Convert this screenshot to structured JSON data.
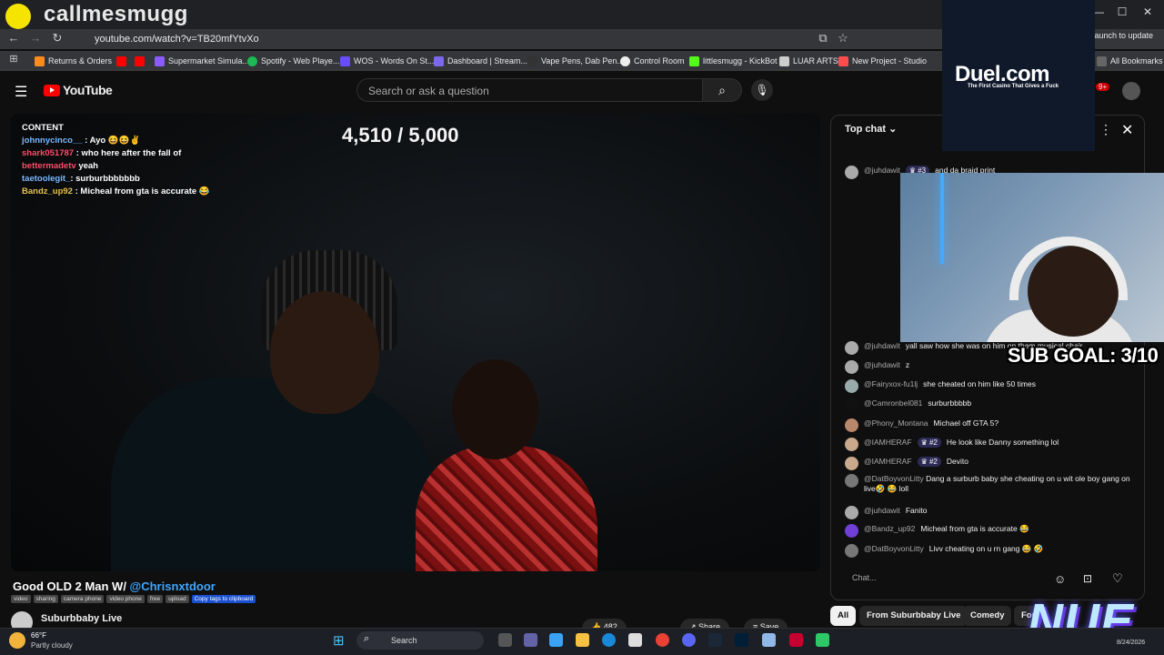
{
  "overlay": {
    "streamer_name": "callmesmugg",
    "counter": "4,510 / 5,000",
    "sub_goal": "SUB GOAL: 3/10",
    "sponsor_title": "Duel.com",
    "sponsor_sub": "The First Casino That Gives a Fuck",
    "brand": "NUE"
  },
  "browser": {
    "url": "youtube.com/watch?v=TB20mfYtvXo",
    "relaunch": "Relaunch to update",
    "bookmarks": [
      "Returns & Orders",
      "Supermarket Simula...",
      "Spotify - Web Playe...",
      "WOS - Words On St...",
      "Dashboard | Stream...",
      "Vape Pens, Dab Pen...",
      "Control Room",
      "littlesmugg - KickBot",
      "LUAR ARTS",
      "New Project - Studio",
      "All Bookmarks"
    ],
    "colors": {
      "frame": "#202124",
      "toolbar": "#35363a"
    }
  },
  "youtube": {
    "logo": "YouTube",
    "search_placeholder": "Search or ask a question",
    "notif_count": "9+"
  },
  "stream_chat": [
    {
      "user": "CONTENT",
      "text": ""
    },
    {
      "user": "johnnycinco__",
      "text": ": Ayo 😆😆✌"
    },
    {
      "user": "shark051787",
      "text": ": who here after the fall of"
    },
    {
      "user": "bettermadetv",
      "text": "yeah"
    },
    {
      "user": "taetoolegit_",
      "text": ": surburbbbbbbb"
    },
    {
      "user": "Bandz_up92",
      "text": ": Micheal from gta is accurate 😂"
    }
  ],
  "video": {
    "title": "Good OLD 2 Man W/ ",
    "title_mention": "@Chrisnxtdoor",
    "tags": [
      "video",
      "sharing",
      "camera phone",
      "video phone",
      "free",
      "upload",
      "Copy tags to clipboard"
    ],
    "channel": "Suburbbaby Live",
    "likes": "482",
    "share": "Share",
    "save": "Save"
  },
  "chat": {
    "header": "Top chat",
    "input_placeholder": "Chat...",
    "messages": [
      {
        "author": "@juhdawit",
        "badge": "♛ #3",
        "text": "and da braid print"
      },
      {
        "author": "@juhdawit",
        "badge": "",
        "text": "yall saw how she was on him on them musical chair"
      },
      {
        "author": "@juhdawit",
        "badge": "",
        "text": "z"
      },
      {
        "author": "@Fairyxox-fu1lj",
        "badge": "",
        "text": "she cheated on him like 50 times"
      },
      {
        "author": "@Camronbel081",
        "badge": "",
        "text": "surburbbbbb"
      },
      {
        "author": "@Phony_Montana",
        "badge": "",
        "text": "Michael off GTA 5?"
      },
      {
        "author": "@IAMHERAF",
        "badge": "♛ #2",
        "text": "He look like Danny something lol"
      },
      {
        "author": "@IAMHERAF",
        "badge": "♛ #2",
        "text": "Devito"
      },
      {
        "author": "@DatBoyvonLitty",
        "badge": "",
        "text": "Dang a surburb baby she cheating on u wit ole boy gang on live🤣 😂 loll"
      },
      {
        "author": "@juhdawit",
        "badge": "",
        "text": "Fanito"
      },
      {
        "author": "@Bandz_up92",
        "badge": "",
        "text": "Micheal from gta is accurate 😂"
      },
      {
        "author": "@DatBoyvonLitty",
        "badge": "",
        "text": "Livv cheating on u rn gang 😂 🤣"
      }
    ]
  },
  "chips": [
    "All",
    "From Suburbbaby Live",
    "Comedy",
    "For"
  ],
  "taskbar": {
    "temp": "66°F",
    "condition": "Partly cloudy",
    "search": "Search",
    "date": "8/24/2026"
  }
}
